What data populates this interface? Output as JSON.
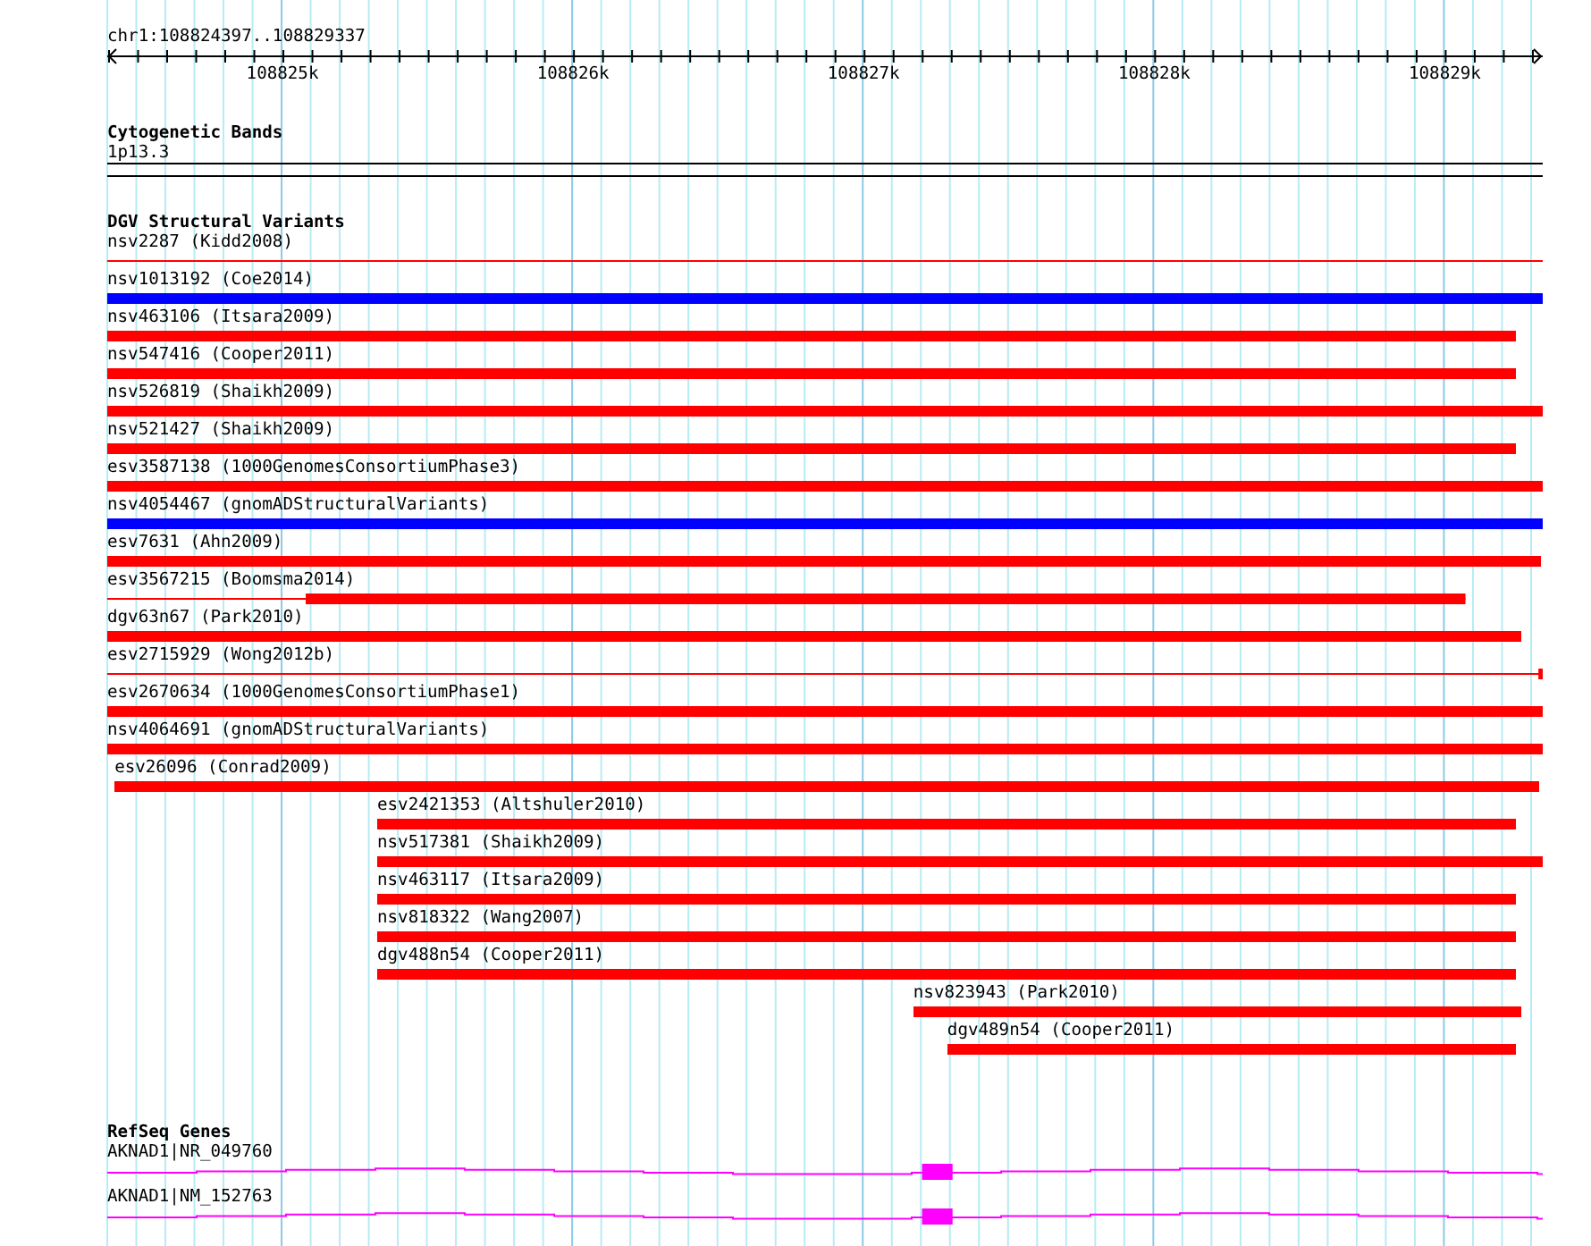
{
  "ruler": {
    "location": "chr1:108824397..108829337",
    "tick_labels": [
      "108825k",
      "108826k",
      "108827k",
      "108828k",
      "108829k"
    ]
  },
  "tracks": [
    {
      "kind": "cytoband",
      "title": "Cytogenetic Bands",
      "features": [
        {
          "label": "1p13.3"
        }
      ]
    },
    {
      "kind": "variants",
      "title": "DGV Structural Variants",
      "features": [
        {
          "label": "nsv2287 (Kidd2008)",
          "color": "#ff0000",
          "kind": "line"
        },
        {
          "label": "nsv1013192 (Coe2014)",
          "color": "#0000ff",
          "kind": "block"
        },
        {
          "label": "nsv463106 (Itsara2009)",
          "color": "#ff0000",
          "kind": "block"
        },
        {
          "label": "nsv547416 (Cooper2011)",
          "color": "#ff0000",
          "kind": "block"
        },
        {
          "label": "nsv526819 (Shaikh2009)",
          "color": "#ff0000",
          "kind": "block"
        },
        {
          "label": "nsv521427 (Shaikh2009)",
          "color": "#ff0000",
          "kind": "block"
        },
        {
          "label": "esv3587138 (1000GenomesConsortiumPhase3)",
          "color": "#ff0000",
          "kind": "block"
        },
        {
          "label": "nsv4054467 (gnomADStructuralVariants)",
          "color": "#0000ff",
          "kind": "block"
        },
        {
          "label": "esv7631 (Ahn2009)",
          "color": "#ff0000",
          "kind": "block"
        },
        {
          "label": "esv3567215 (Boomsma2014)",
          "color": "#ff0000",
          "kind": "line"
        },
        {
          "label": "dgv63n67 (Park2010)",
          "color": "#ff0000",
          "kind": "block"
        },
        {
          "label": "esv2715929 (Wong2012b)",
          "color": "#ff0000",
          "kind": "line"
        },
        {
          "label": "esv2670634 (1000GenomesConsortiumPhase1)",
          "color": "#ff0000",
          "kind": "block"
        },
        {
          "label": "nsv4064691 (gnomADStructuralVariants)",
          "color": "#ff0000",
          "kind": "block"
        },
        {
          "label": "esv26096 (Conrad2009)",
          "color": "#ff0000",
          "kind": "block"
        },
        {
          "label": "esv2421353 (Altshuler2010)",
          "color": "#ff0000",
          "kind": "block"
        },
        {
          "label": "nsv517381 (Shaikh2009)",
          "color": "#ff0000",
          "kind": "block"
        },
        {
          "label": "nsv463117 (Itsara2009)",
          "color": "#ff0000",
          "kind": "block"
        },
        {
          "label": "nsv818322 (Wang2007)",
          "color": "#ff0000",
          "kind": "block"
        },
        {
          "label": "dgv488n54 (Cooper2011)",
          "color": "#ff0000",
          "kind": "block"
        },
        {
          "label": "nsv823943 (Park2010)",
          "color": "#ff0000",
          "kind": "block"
        },
        {
          "label": "dgv489n54 (Cooper2011)",
          "color": "#ff0000",
          "kind": "block"
        }
      ]
    },
    {
      "kind": "genes",
      "title": "RefSeq Genes",
      "features": [
        {
          "label": "AKNAD1|NR_049760"
        },
        {
          "label": "AKNAD1|NM_152763"
        }
      ]
    }
  ]
}
